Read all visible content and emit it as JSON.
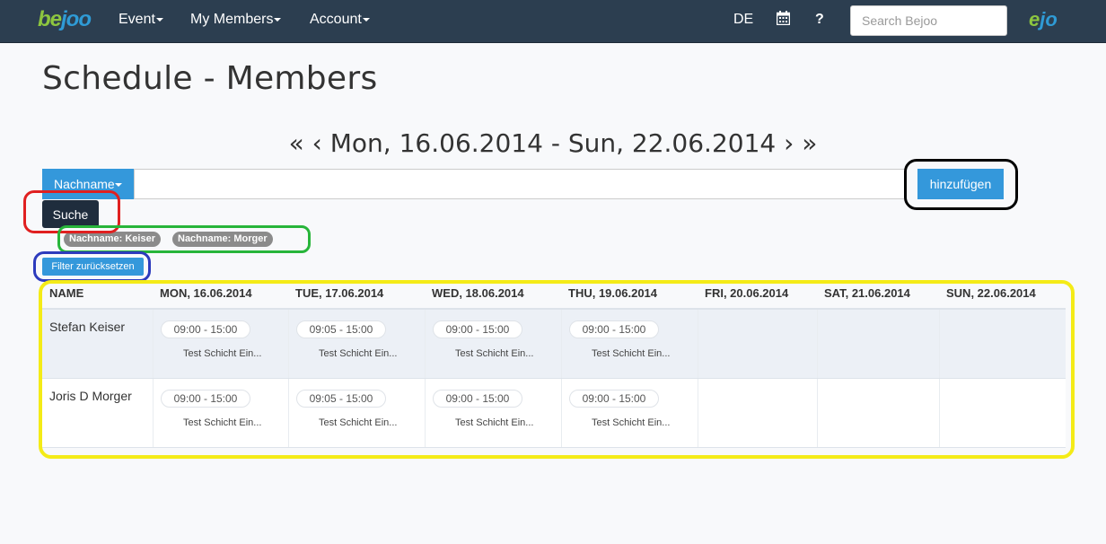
{
  "navbar": {
    "logo": {
      "part1": "be",
      "part2": "joo"
    },
    "menu": [
      {
        "label": "Event"
      },
      {
        "label": "My Members"
      },
      {
        "label": "Account"
      }
    ],
    "language": "DE",
    "help": "?",
    "search_placeholder": "Search Bejoo",
    "logo_right": {
      "part1": "e",
      "part2": "jo"
    }
  },
  "page": {
    "title": "Schedule - Members",
    "week": {
      "first": "«",
      "prev": "‹",
      "range": "Mon, 16.06.2014 - Sun, 22.06.2014",
      "next": "›",
      "last": "»"
    }
  },
  "filter": {
    "field_label": "Nachname",
    "input_value": "",
    "add_label": "hinzufügen",
    "search_label": "Suche",
    "tags": [
      "Nachname: Keiser",
      "Nachname: Morger"
    ],
    "reset_label": "Filter zurücksetzen"
  },
  "table": {
    "headers": [
      "NAME",
      "MON, 16.06.2014",
      "TUE, 17.06.2014",
      "WED, 18.06.2014",
      "THU, 19.06.2014",
      "FRI, 20.06.2014",
      "SAT, 21.06.2014",
      "SUN, 22.06.2014"
    ],
    "rows": [
      {
        "name": "Stefan Keiser",
        "shifts": [
          {
            "time": "09:00 - 15:00",
            "label": "Test Schicht Ein..."
          },
          {
            "time": "09:05 - 15:00",
            "label": "Test Schicht Ein..."
          },
          {
            "time": "09:00 - 15:00",
            "label": "Test Schicht Ein..."
          },
          {
            "time": "09:00 - 15:00",
            "label": "Test Schicht Ein..."
          }
        ]
      },
      {
        "name": "Joris D Morger",
        "shifts": [
          {
            "time": "09:00 - 15:00",
            "label": "Test Schicht Ein..."
          },
          {
            "time": "09:05 - 15:00",
            "label": "Test Schicht Ein..."
          },
          {
            "time": "09:00 - 15:00",
            "label": "Test Schicht Ein..."
          },
          {
            "time": "09:00 - 15:00",
            "label": "Test Schicht Ein..."
          }
        ]
      }
    ]
  },
  "colors": {
    "navbar": "#2c3e50",
    "accent": "#3498db",
    "annotation_red": "#e02020",
    "annotation_black": "#000000",
    "annotation_green": "#27b53a",
    "annotation_blue": "#2d3bbd",
    "annotation_yellow": "#f4eb17"
  }
}
